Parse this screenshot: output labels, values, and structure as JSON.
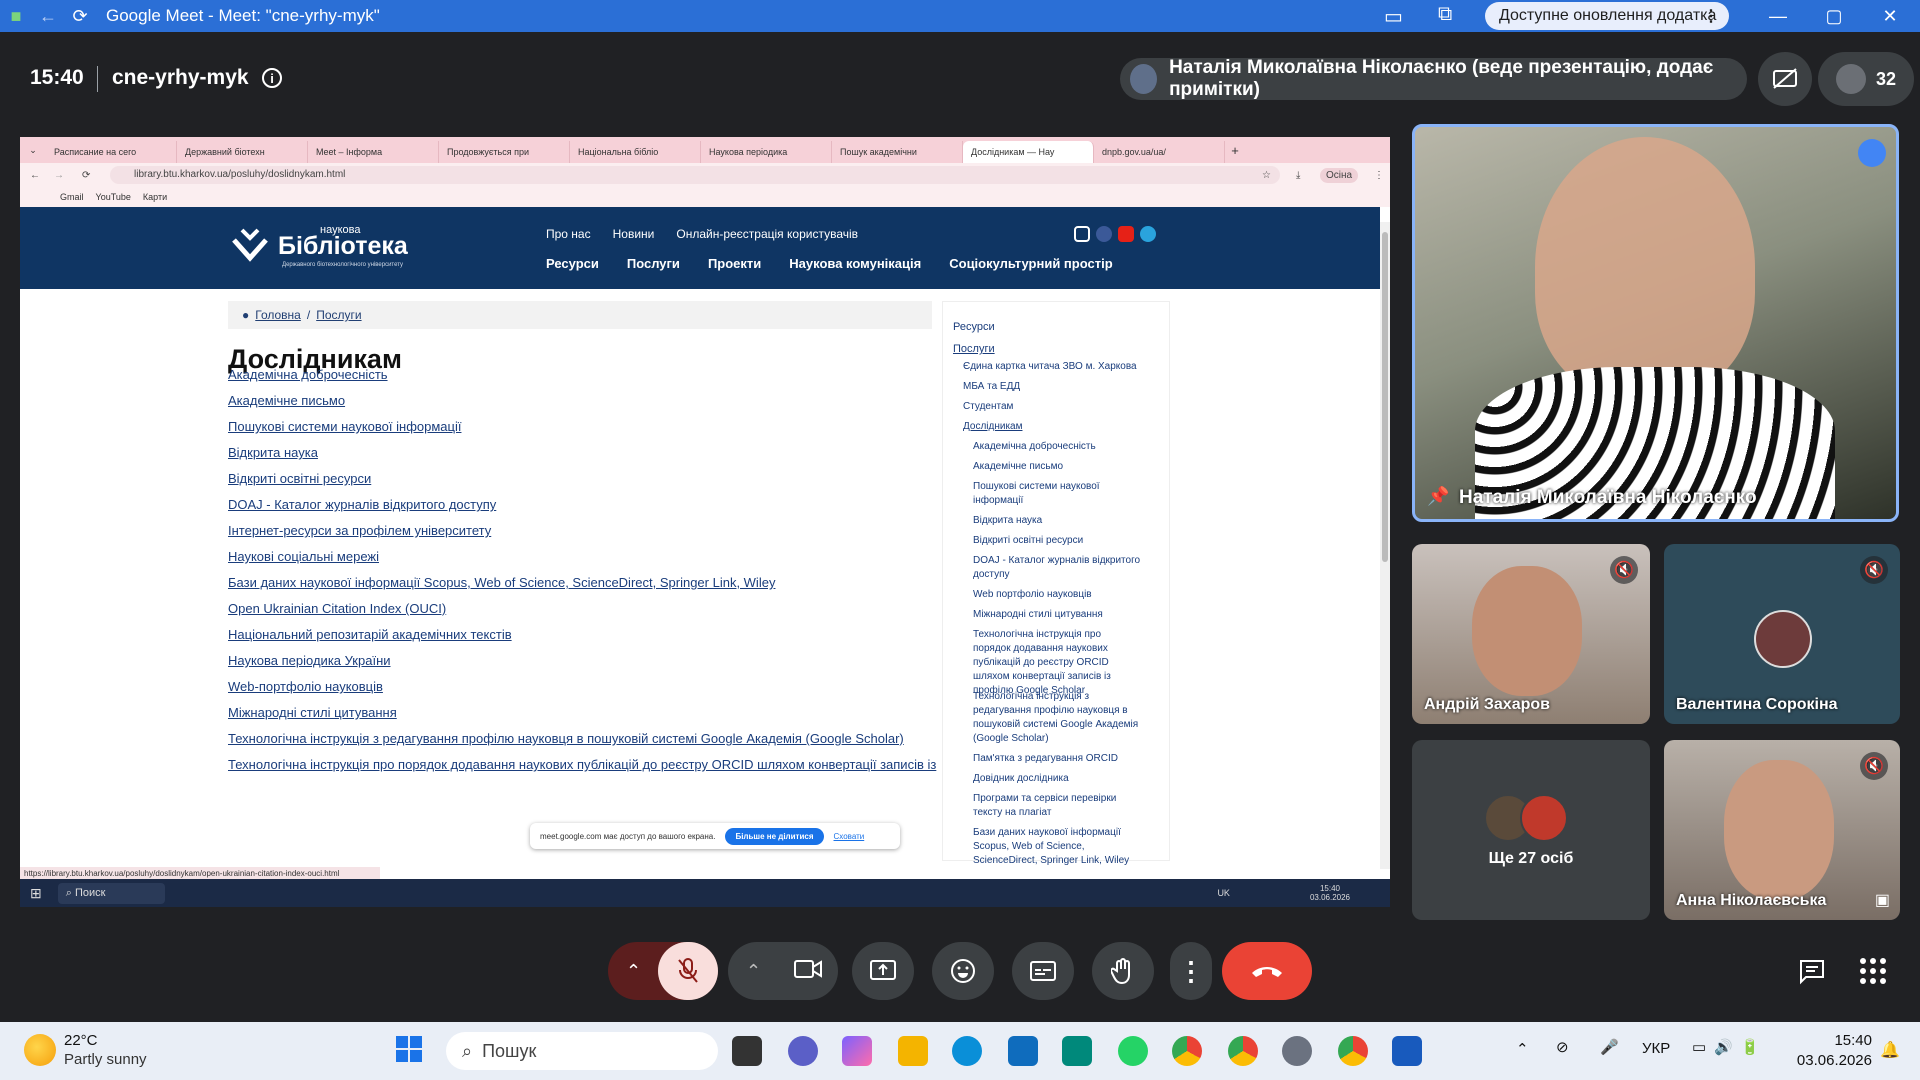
{
  "window": {
    "title": "Google Meet - Meet: \"cne-yrhy-myk\"",
    "update_label": "Доступне оновлення додатка"
  },
  "meet": {
    "time": "15:40",
    "code": "cne-yrhy-myk",
    "presenter_label": "Наталія Миколаївна Ніколаєнко (веде презентацію, додає примітки)",
    "participants_count": "32"
  },
  "browser": {
    "tabs": [
      "Расписание на сего",
      "Державний біотехн",
      "Meet – Інформа",
      "Продовжується при",
      "Національна бібліо",
      "Наукова періодика",
      "Пошук академічни",
      "Дослідникам — Нау",
      "dnpb.gov.ua/ua/"
    ],
    "url": "library.btu.kharkov.ua/posluhy/doslidnykam.html",
    "profile": "Осіна",
    "bookmarks": [
      "Gmail",
      "YouTube",
      "Карти"
    ],
    "status_url": "https://library.btu.kharkov.ua/posluhy/doslidnykam/open-ukrainian-citation-index-ouci.html"
  },
  "site": {
    "logo_small": "наукова",
    "logo_big": "Бібліотека",
    "logo_sub": "Державного біотехнологічного університету",
    "top_nav": [
      "Про нас",
      "Новини",
      "Онлайн-реєстрація користувачів"
    ],
    "main_nav": [
      "Ресурси",
      "Послуги",
      "Проекти",
      "Наукова комунікація",
      "Соціокультурний простір"
    ],
    "breadcrumb": [
      "Головна",
      "Послуги"
    ],
    "heading": "Дослідникам",
    "links": [
      "Академічна доброчесність",
      "Академічне письмо",
      "Пошукові системи наукової інформації",
      "Відкрита наука",
      "Відкриті освітні ресурси",
      "DOAJ - Каталог журналів відкритого доступу",
      "Інтернет-ресурси за профілем університету",
      "Наукові соціальні мережі",
      "Бази даних наукової інформації Scopus, Web of Science, ScienceDirect, Springer Link, Wiley",
      "Open Ukrainian Citation Index (OUCI)",
      "Національний репозитарій академічних текстів",
      "Наукова періодика України",
      "Web-портфоліо науковців",
      "Міжнародні стилі цитування",
      "Технологічна інструкція з редагування профілю науковця в пошуковій системі Google Академія (Google Scholar)",
      "Технологічна інструкція про порядок додавання наукових публікацій до реєстру ORCID шляхом конвертації записів із"
    ],
    "sidebar": {
      "top": [
        "Ресурси",
        "Послуги"
      ],
      "services": [
        "Єдина картка читача ЗВО м. Харкова",
        "МБА та ЕДД",
        "Студентам",
        "Дослідникам"
      ],
      "researchers": [
        "Академічна доброчесність",
        "Академічне письмо",
        "Пошукові системи наукової інформації",
        "Відкрита наука",
        "Відкриті освітні ресурси",
        "DOAJ - Каталог журналів відкритого доступу",
        "Web портфоліо науковців",
        "Міжнародні стилі цитування",
        "Технологічна інструкція про порядок додавання наукових публікацій до реєстру ORCID шляхом конвертації записів із профілю Google Scholar",
        "Технологічна інструкція з редагування профілю науковця в пошуковій системі Google Академія (Google Scholar)",
        "Пам'ятка з редагування ORCID",
        "Довідник дослідника",
        "Програми та сервіси перевірки тексту на плагіат",
        "Бази даних наукової інформації Scopus, Web of Science, ScienceDirect, Springer Link, Wiley"
      ]
    },
    "share_notice": "meet.google.com має доступ до вашого екрана.",
    "share_stop": "Більше не ділитися",
    "share_hide": "Сховати"
  },
  "inner_taskbar": {
    "search": "Поиск",
    "lang": "UK",
    "time": "15:40",
    "date": "03.06.2026"
  },
  "tiles": {
    "main": "Наталія Миколаївна Ніколаєнко",
    "t1": "Андрій Захаров",
    "t2": "Валентина Сорокіна",
    "t3": "Ще 27 осіб",
    "t4": "Анна Ніколаєвська"
  },
  "taskbar": {
    "weather_temp": "22°C",
    "weather_desc": "Partly sunny",
    "search": "Пошук",
    "lang": "УКР",
    "time": "15:40",
    "date": "03.06.2026"
  },
  "colors": {
    "titlebar": "#2b6fd6",
    "meet_bg": "#202124",
    "end_call": "#ea4335",
    "mic_off_bg": "#f9dedc",
    "site_nav": "#0f3563"
  }
}
